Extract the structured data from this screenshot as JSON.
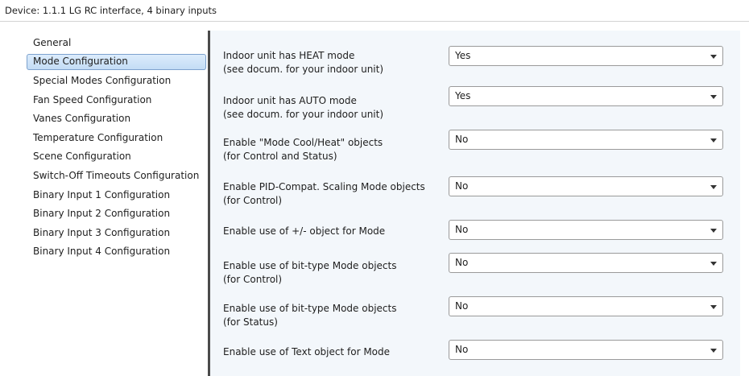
{
  "window": {
    "title": "Device: 1.1.1  LG RC interface, 4 binary inputs"
  },
  "sidebar": {
    "items": [
      {
        "label": "General"
      },
      {
        "label": "Mode Configuration",
        "selected": true
      },
      {
        "label": "Special Modes Configuration"
      },
      {
        "label": "Fan Speed Configuration"
      },
      {
        "label": "Vanes Configuration"
      },
      {
        "label": "Temperature Configuration"
      },
      {
        "label": "Scene Configuration"
      },
      {
        "label": "Switch-Off Timeouts Configuration"
      },
      {
        "label": "Binary Input 1 Configuration"
      },
      {
        "label": "Binary Input 2 Configuration"
      },
      {
        "label": "Binary Input 3 Configuration"
      },
      {
        "label": "Binary Input 4 Configuration"
      }
    ]
  },
  "settings": [
    {
      "line1": "Indoor unit has HEAT mode",
      "line2": "(see docum. for your indoor unit)",
      "value": "Yes"
    },
    {
      "line1": "Indoor unit has AUTO mode",
      "line2": "(see docum. for your indoor unit)",
      "value": "Yes"
    },
    {
      "line1": "Enable \"Mode Cool/Heat\" objects",
      "line2": "(for Control and Status)",
      "value": "No"
    },
    {
      "line1": "Enable PID-Compat. Scaling Mode objects",
      "line2": "(for Control)",
      "value": "No"
    },
    {
      "line1": "Enable use of +/- object for Mode",
      "line2": "",
      "value": "No"
    },
    {
      "line1": "Enable use of bit-type Mode objects",
      "line2": "(for Control)",
      "value": "No"
    },
    {
      "line1": "Enable use of bit-type Mode objects",
      "line2": "(for Status)",
      "value": "No"
    },
    {
      "line1": "Enable use of Text object for Mode",
      "line2": "",
      "value": "No"
    }
  ],
  "icons": {
    "dropdown": "chevron-down-icon"
  }
}
